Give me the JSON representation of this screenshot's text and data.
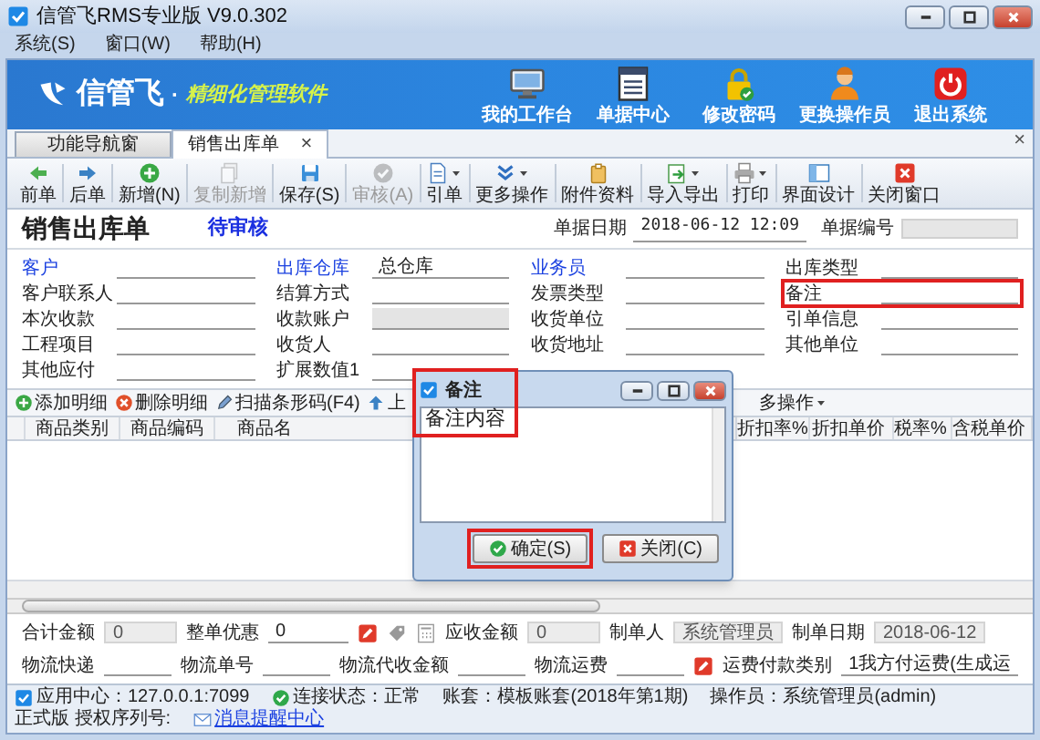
{
  "window": {
    "title": "信管飞RMS专业版 V9.0.302"
  },
  "menu": [
    "系统(S)",
    "窗口(W)",
    "帮助(H)"
  ],
  "banner": {
    "logo": "信管飞",
    "separator": "·",
    "slogan": "精细化管理软件",
    "shortcuts": [
      {
        "label": "我的工作台"
      },
      {
        "label": "单据中心"
      },
      {
        "label": "修改密码"
      },
      {
        "label": "更换操作员"
      },
      {
        "label": "退出系统"
      }
    ]
  },
  "tabs": [
    {
      "label": "功能导航窗",
      "selected": false
    },
    {
      "label": "销售出库单",
      "selected": true,
      "close": "×"
    }
  ],
  "panel_close": "×",
  "toolbar": [
    {
      "label": "前单",
      "disabled": false,
      "dropdown": false
    },
    {
      "label": "后单",
      "disabled": false,
      "dropdown": false
    },
    {
      "label": "新增(N)",
      "disabled": false,
      "dropdown": false
    },
    {
      "label": "复制新增",
      "disabled": true,
      "dropdown": false
    },
    {
      "label": "保存(S)",
      "disabled": false,
      "dropdown": false
    },
    {
      "label": "审核(A)",
      "disabled": true,
      "dropdown": false
    },
    {
      "label": "引单",
      "disabled": false,
      "dropdown": true
    },
    {
      "label": "更多操作",
      "disabled": false,
      "dropdown": true
    },
    {
      "label": "附件资料",
      "disabled": false,
      "dropdown": false
    },
    {
      "label": "导入导出",
      "disabled": false,
      "dropdown": true
    },
    {
      "label": "打印",
      "disabled": false,
      "dropdown": true
    },
    {
      "label": "界面设计",
      "disabled": false,
      "dropdown": false
    },
    {
      "label": "关闭窗口",
      "disabled": false,
      "dropdown": false
    }
  ],
  "form": {
    "title": "销售出库单",
    "status": "待审核",
    "date_label": "单据日期",
    "date": "2018-06-12 12:09",
    "number_label": "单据编号",
    "fields": [
      {
        "label": "客户",
        "link": true,
        "disabled": false,
        "highlighted": false
      },
      {
        "label": "出库仓库",
        "value": "总仓库",
        "link": true,
        "disabled": false,
        "highlighted": false
      },
      {
        "label": "业务员",
        "link": true,
        "disabled": false,
        "highlighted": false
      },
      {
        "label": "出库类型",
        "link": false,
        "disabled": false,
        "highlighted": false
      },
      {
        "label": "客户联系人",
        "link": false,
        "disabled": false,
        "highlighted": false
      },
      {
        "label": "结算方式",
        "link": false,
        "disabled": false,
        "highlighted": false
      },
      {
        "label": "发票类型",
        "link": false,
        "disabled": false,
        "highlighted": false
      },
      {
        "label": "备注",
        "link": false,
        "disabled": false,
        "highlighted": true
      },
      {
        "label": "本次收款",
        "link": false,
        "disabled": false,
        "highlighted": false
      },
      {
        "label": "收款账户",
        "link": false,
        "disabled": true,
        "highlighted": false
      },
      {
        "label": "收货单位",
        "link": false,
        "disabled": false,
        "highlighted": false
      },
      {
        "label": "引单信息",
        "link": false,
        "disabled": false,
        "highlighted": false
      },
      {
        "label": "工程项目",
        "link": false,
        "disabled": false,
        "highlighted": false
      },
      {
        "label": "收货人",
        "link": false,
        "disabled": false,
        "highlighted": false
      },
      {
        "label": "收货地址",
        "link": false,
        "disabled": false,
        "highlighted": false
      },
      {
        "label": "其他单位",
        "link": false,
        "disabled": false,
        "highlighted": false
      },
      {
        "label": "其他应付",
        "link": false,
        "disabled": false,
        "highlighted": false
      },
      {
        "label": "扩展数值1",
        "link": false,
        "disabled": false,
        "highlighted": false
      }
    ]
  },
  "detail_toolbar": [
    {
      "label": "添加明细"
    },
    {
      "label": "删除明细"
    },
    {
      "label": "扫描条形码(F4)"
    },
    {
      "label": "上"
    }
  ],
  "detail_more": {
    "label": "多操作"
  },
  "table": {
    "columns": [
      {
        "label": "商品类别",
        "kind": "left"
      },
      {
        "label": "商品编码",
        "kind": "left"
      },
      {
        "label": "商品名",
        "kind": "left"
      },
      {
        "label": "折扣率%",
        "kind": "right"
      },
      {
        "label": "折扣单价",
        "kind": "right"
      },
      {
        "label": "税率%",
        "kind": "right"
      },
      {
        "label": "含税单价",
        "kind": "right"
      }
    ]
  },
  "footer": {
    "rows": [
      [
        {
          "label": "合计金额",
          "value": "0",
          "kind": "readonly"
        },
        {
          "label": "整单优惠",
          "value": "0",
          "kind": "input"
        },
        {
          "label": "应收金额",
          "value": "0",
          "kind": "readonly"
        },
        {
          "label": "制单人",
          "value": "系统管理员",
          "kind": "readonly"
        },
        {
          "label": "制单日期",
          "value": "2018-06-12",
          "kind": "readonly"
        }
      ],
      [
        {
          "label": "物流快递",
          "kind": "input"
        },
        {
          "label": "物流单号",
          "kind": "input"
        },
        {
          "label": "物流代收金额",
          "kind": "input"
        },
        {
          "label": "物流运费",
          "kind": "input"
        },
        {
          "label": "运费付款类别",
          "value": "1我方付运费(生成运",
          "kind": "input"
        }
      ]
    ]
  },
  "status_bar": [
    {
      "text": "应用中心：127.0.0.1:7099",
      "link": false
    },
    {
      "text": "连接状态：正常",
      "link": false
    },
    {
      "text": "账套：模板账套(2018年第1期)",
      "link": false
    },
    {
      "text": "操作员：系统管理员(admin)",
      "link": false
    },
    {
      "text": "正式版 授权序列号:",
      "link": false
    },
    {
      "text": "消息提醒中心",
      "link": true
    }
  ],
  "dialog": {
    "title": "备注",
    "title_highlighted": true,
    "content": "备注内容",
    "buttons": [
      {
        "label": "确定(S)",
        "highlighted": true
      },
      {
        "label": "关闭(C)",
        "highlighted": false
      }
    ]
  }
}
